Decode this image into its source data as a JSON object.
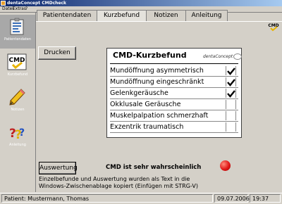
{
  "window": {
    "title": "dentaConcept CMDcheck"
  },
  "menu": {
    "items": [
      "Datei",
      "Extras",
      "?"
    ]
  },
  "sidebar": {
    "items": [
      {
        "label": "Patientendaten",
        "icon": "patient-data-icon",
        "active": true
      },
      {
        "label": "Kurzbefund",
        "icon": "cmd-check-icon",
        "active": false
      },
      {
        "label": "Notizen",
        "icon": "pencil-icon",
        "active": false
      },
      {
        "label": "Anleitung",
        "icon": "help-question-icon",
        "active": false
      }
    ]
  },
  "tabs": [
    {
      "label": "Patientendaten",
      "active": false
    },
    {
      "label": "Kurzbefund",
      "active": true
    },
    {
      "label": "Notizen",
      "active": false
    },
    {
      "label": "Anleitung",
      "active": false
    }
  ],
  "buttons": {
    "print": "Drucken",
    "evaluate": "Auswertung"
  },
  "kurzbefund": {
    "title": "CMD-Kurzbefund",
    "logo": "dentaConcept",
    "findings": [
      {
        "label": "Mundöffnung asymmetrisch",
        "checked": true
      },
      {
        "label": "Mundöffnung eingeschränkt",
        "checked": true
      },
      {
        "label": "Gelenkgeräusche",
        "checked": true
      },
      {
        "label": "Okklusale Geräusche",
        "checked": false
      },
      {
        "label": "Muskelpalpation schmerzhaft",
        "checked": false
      },
      {
        "label": "Exzentrik traumatisch",
        "checked": false
      }
    ]
  },
  "result": {
    "text": "CMD ist sehr wahrscheinlich",
    "indicator_color": "#e01818"
  },
  "info": {
    "line1": "Einzelbefunde und Auswertung wurden als Text in die",
    "line2": "Windows-Zwischenablage kopiert (Einfügen mit STRG-V)"
  },
  "status": {
    "patient": "Patient: Mustermann, Thomas",
    "date": "09.07.2006",
    "time": "19:37"
  }
}
